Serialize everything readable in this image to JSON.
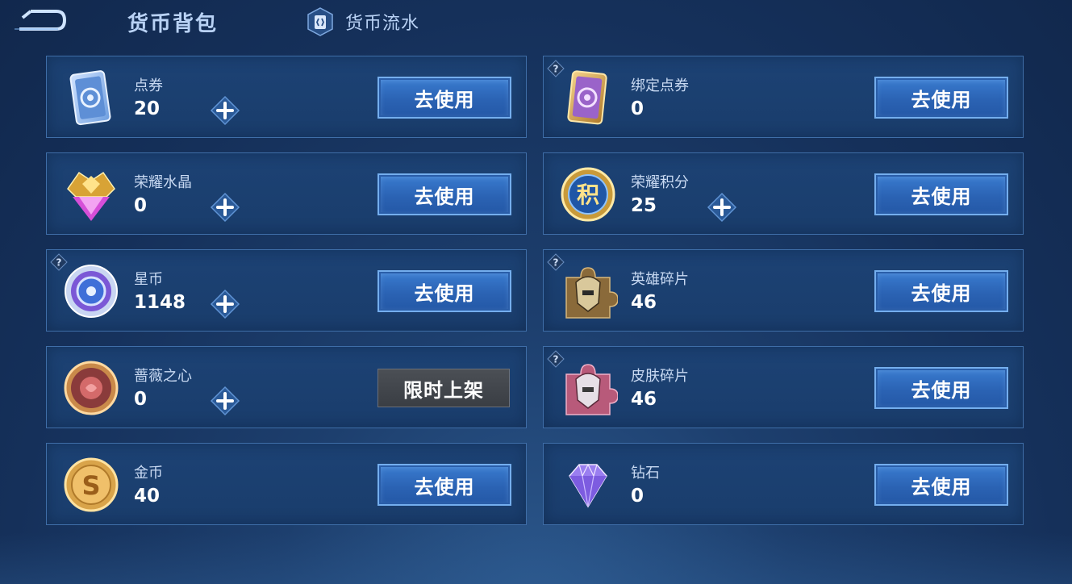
{
  "header": {
    "title": "货币背包",
    "flow_tab_label": "货币流水"
  },
  "colors": {
    "button_blue": "#2b63b4",
    "button_border": "#74aeee",
    "card_bg": "#1b3f70",
    "card_border": "#3f6ea8",
    "limited_gray": "#3f4349"
  },
  "button_labels": {
    "use": "去使用",
    "limited": "限时上架"
  },
  "items": [
    {
      "name": "点券",
      "value": "20",
      "icon": "coupon-card-icon",
      "has_plus": true,
      "has_help": false,
      "button": "use"
    },
    {
      "name": "绑定点券",
      "value": "0",
      "icon": "bound-coupon-card-icon",
      "has_plus": false,
      "has_help": true,
      "button": "use"
    },
    {
      "name": "荣耀水晶",
      "value": "0",
      "icon": "glory-crystal-icon",
      "has_plus": true,
      "has_help": false,
      "button": "use"
    },
    {
      "name": "荣耀积分",
      "value": "25",
      "icon": "glory-points-icon",
      "has_plus": true,
      "has_help": false,
      "button": "use"
    },
    {
      "name": "星币",
      "value": "1148",
      "icon": "star-coin-icon",
      "has_plus": true,
      "has_help": true,
      "button": "use"
    },
    {
      "name": "英雄碎片",
      "value": "46",
      "icon": "hero-shard-icon",
      "has_plus": false,
      "has_help": true,
      "button": "use"
    },
    {
      "name": "蔷薇之心",
      "value": "0",
      "icon": "rose-heart-icon",
      "has_plus": true,
      "has_help": false,
      "button": "limited"
    },
    {
      "name": "皮肤碎片",
      "value": "46",
      "icon": "skin-shard-icon",
      "has_plus": false,
      "has_help": true,
      "button": "use"
    },
    {
      "name": "金币",
      "value": "40",
      "icon": "gold-coin-icon",
      "has_plus": false,
      "has_help": false,
      "button": "use"
    },
    {
      "name": "钻石",
      "value": "0",
      "icon": "diamond-icon",
      "has_plus": false,
      "has_help": false,
      "button": "use"
    }
  ]
}
